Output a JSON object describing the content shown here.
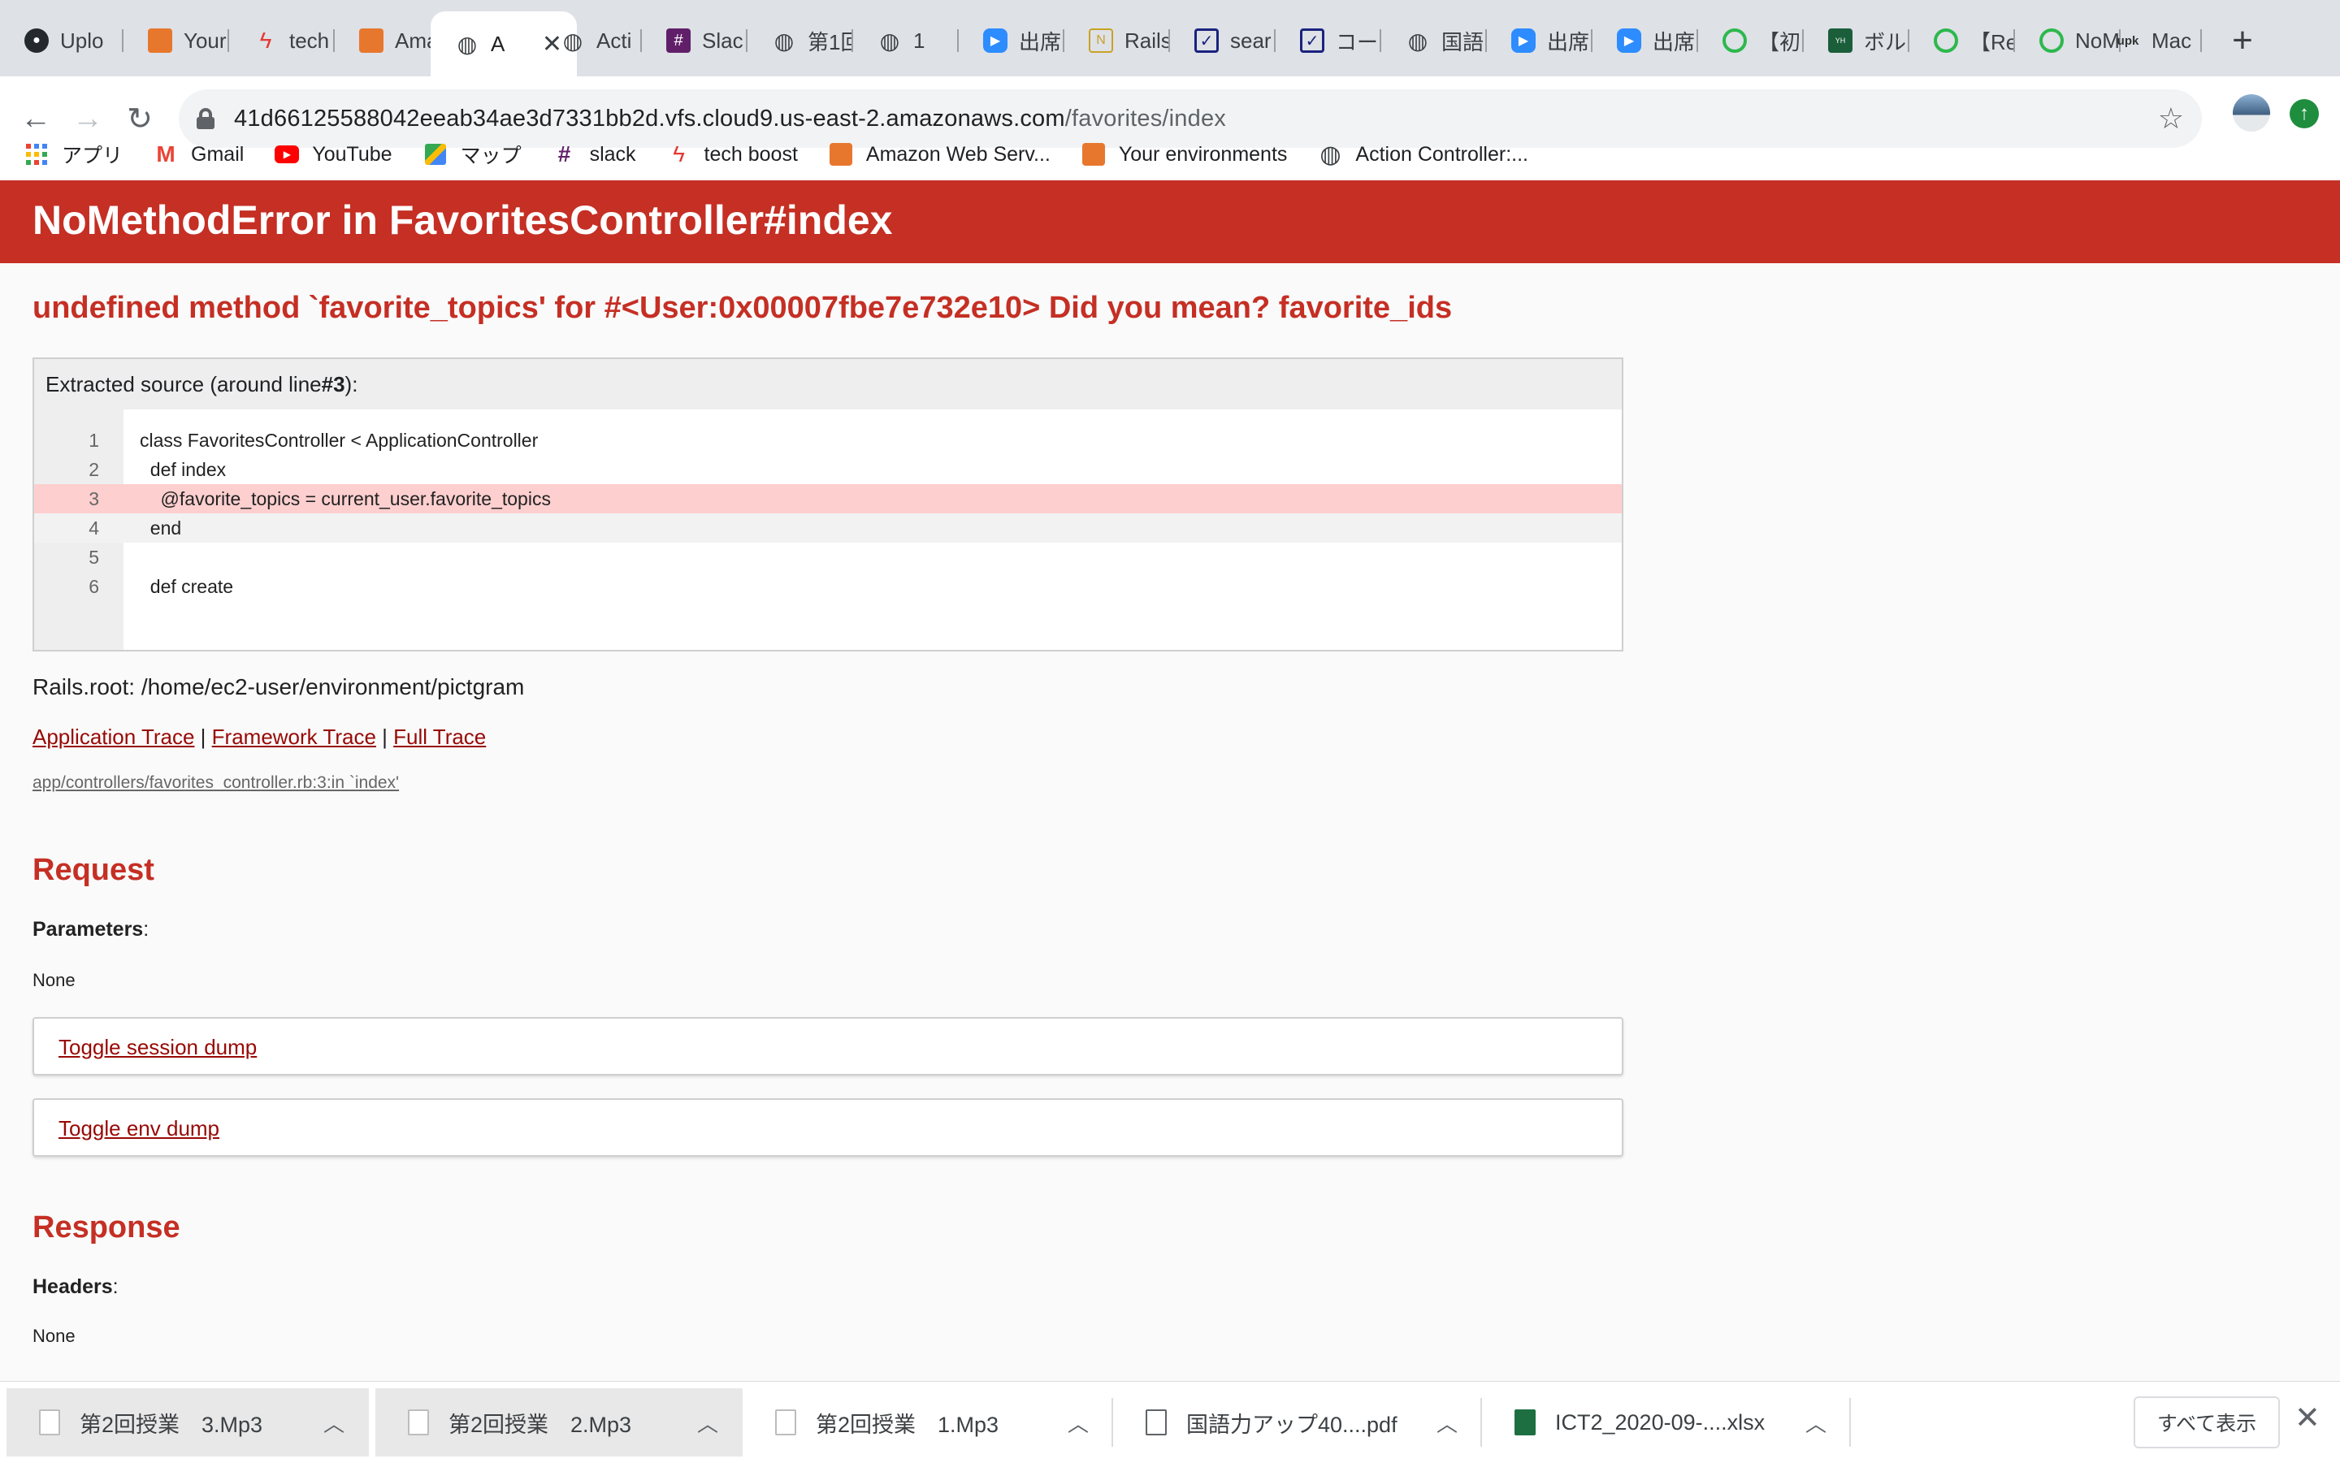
{
  "tabs": [
    {
      "title": "Uplo",
      "icon": "github-icon",
      "color": "#24292e"
    },
    {
      "title": "Your",
      "icon": "aws-icon",
      "color": "#e8772e"
    },
    {
      "title": "tech",
      "icon": "tech-boost-icon",
      "color": "#e53935"
    },
    {
      "title": "Ama",
      "icon": "aws-icon",
      "color": "#e8772e"
    },
    {
      "title": "A",
      "icon": "globe-icon",
      "color": "#5f6368",
      "active": true
    },
    {
      "title": "Acti",
      "icon": "globe-icon",
      "color": "#5f6368"
    },
    {
      "title": "Slac",
      "icon": "slack-icon",
      "color": "#611f69"
    },
    {
      "title": "第1回",
      "icon": "globe-icon",
      "color": "#5f6368"
    },
    {
      "title": "1",
      "icon": "globe-icon",
      "color": "#5f6368"
    },
    {
      "title": "出席",
      "icon": "zoom-icon",
      "color": "#2d8cff"
    },
    {
      "title": "Rails",
      "icon": "notion-icon",
      "color": "#c9a227"
    },
    {
      "title": "sear",
      "icon": "checkbox-icon",
      "color": "#1a237e"
    },
    {
      "title": "コー",
      "icon": "checkbox-icon",
      "color": "#1a237e"
    },
    {
      "title": "国語",
      "icon": "globe-icon",
      "color": "#5f6368"
    },
    {
      "title": "出席",
      "icon": "zoom-icon",
      "color": "#2d8cff"
    },
    {
      "title": "出席",
      "icon": "zoom-icon",
      "color": "#2d8cff"
    },
    {
      "title": "【初",
      "icon": "green-circle-icon",
      "color": "#2db84d"
    },
    {
      "title": "ボル",
      "icon": "yamahack-icon",
      "color": "#1b5e3a"
    },
    {
      "title": "【Re",
      "icon": "green-circle-icon",
      "color": "#2db84d"
    },
    {
      "title": "NoM",
      "icon": "green-circle-icon",
      "color": "#2db84d"
    },
    {
      "title": "Mac",
      "icon": "upk-icon",
      "color": "#333333"
    }
  ],
  "omnibox": {
    "host": "41d66125588042eeab34ae3d7331bb2d.vfs.cloud9.us-east-2.amazonaws.com",
    "path": "/favorites/index"
  },
  "bookmarks": [
    {
      "label": "アプリ",
      "icon": "apps-grid-icon"
    },
    {
      "label": "Gmail",
      "icon": "gmail-icon"
    },
    {
      "label": "YouTube",
      "icon": "youtube-icon"
    },
    {
      "label": "マップ",
      "icon": "maps-icon"
    },
    {
      "label": "slack",
      "icon": "slack-icon"
    },
    {
      "label": "tech boost",
      "icon": "tech-boost-icon"
    },
    {
      "label": "Amazon Web Serv...",
      "icon": "aws-icon"
    },
    {
      "label": "Your environments",
      "icon": "aws-icon"
    },
    {
      "label": "Action Controller:...",
      "icon": "globe-icon"
    }
  ],
  "error": {
    "title": "NoMethodError in FavoritesController#index",
    "message": "undefined method `favorite_topics' for #<User:0x00007fbe7e732e10> Did you mean?  favorite_ids"
  },
  "source": {
    "header_prefix": "Extracted source (around line ",
    "header_line": "#3",
    "header_suffix": "):",
    "lines": [
      {
        "num": "1",
        "code": "class FavoritesController < ApplicationController"
      },
      {
        "num": "2",
        "code": "  def index"
      },
      {
        "num": "3",
        "code": "    @favorite_topics = current_user.favorite_topics"
      },
      {
        "num": "4",
        "code": "  end"
      },
      {
        "num": "5",
        "code": ""
      },
      {
        "num": "6",
        "code": "  def create"
      }
    ]
  },
  "rails_root": "Rails.root: /home/ec2-user/environment/pictgram",
  "traces": {
    "application": "Application Trace",
    "framework": "Framework Trace",
    "full": "Full Trace",
    "sep": " | ",
    "line": "app/controllers/favorites_controller.rb:3:in `index'"
  },
  "request": {
    "heading": "Request",
    "params_label": "Parameters",
    "params_value": "None",
    "toggle_session": "Toggle session dump",
    "toggle_env": "Toggle env dump"
  },
  "response": {
    "heading": "Response",
    "headers_label": "Headers",
    "headers_value": "None"
  },
  "downloads": [
    {
      "name": "第2回授業　3.Mp3"
    },
    {
      "name": "第2回授業　2.Mp3"
    },
    {
      "name": "第2回授業　1.Mp3"
    },
    {
      "name": "国語力アップ40....pdf"
    },
    {
      "name": "ICT2_2020-09-....xlsx"
    }
  ],
  "show_all": "すべて表示",
  "colors": {
    "error_red": "#c52f24",
    "link": "#980905",
    "highlight": "#fecfcf"
  }
}
